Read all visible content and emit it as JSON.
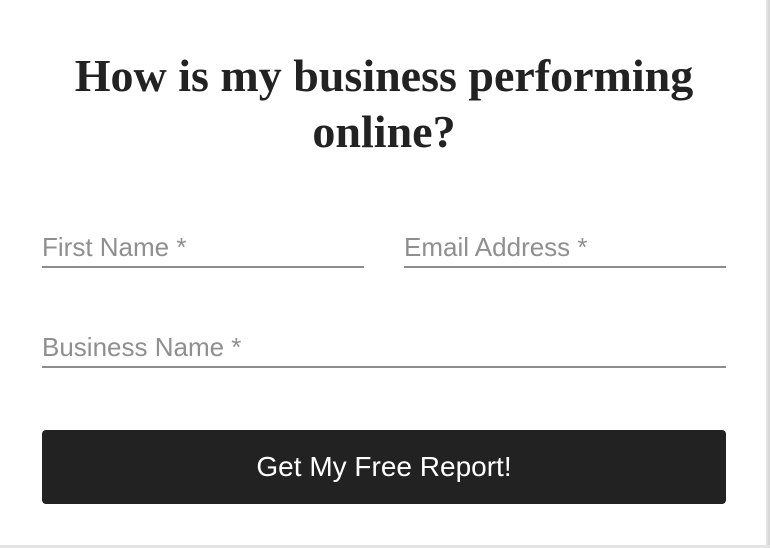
{
  "form": {
    "title": "How is my business performing online?",
    "fields": {
      "first_name": {
        "value": "",
        "placeholder": "First Name *"
      },
      "email": {
        "value": "",
        "placeholder": "Email Address *"
      },
      "business_name": {
        "value": "",
        "placeholder": "Business Name *"
      }
    },
    "submit_label": "Get My Free Report!"
  },
  "colors": {
    "background": "#ffffff",
    "heading_text": "#222222",
    "placeholder_text": "#8f8f8f",
    "field_underline": "#8c8c8c",
    "button_background": "#222222",
    "button_text": "#ffffff"
  }
}
